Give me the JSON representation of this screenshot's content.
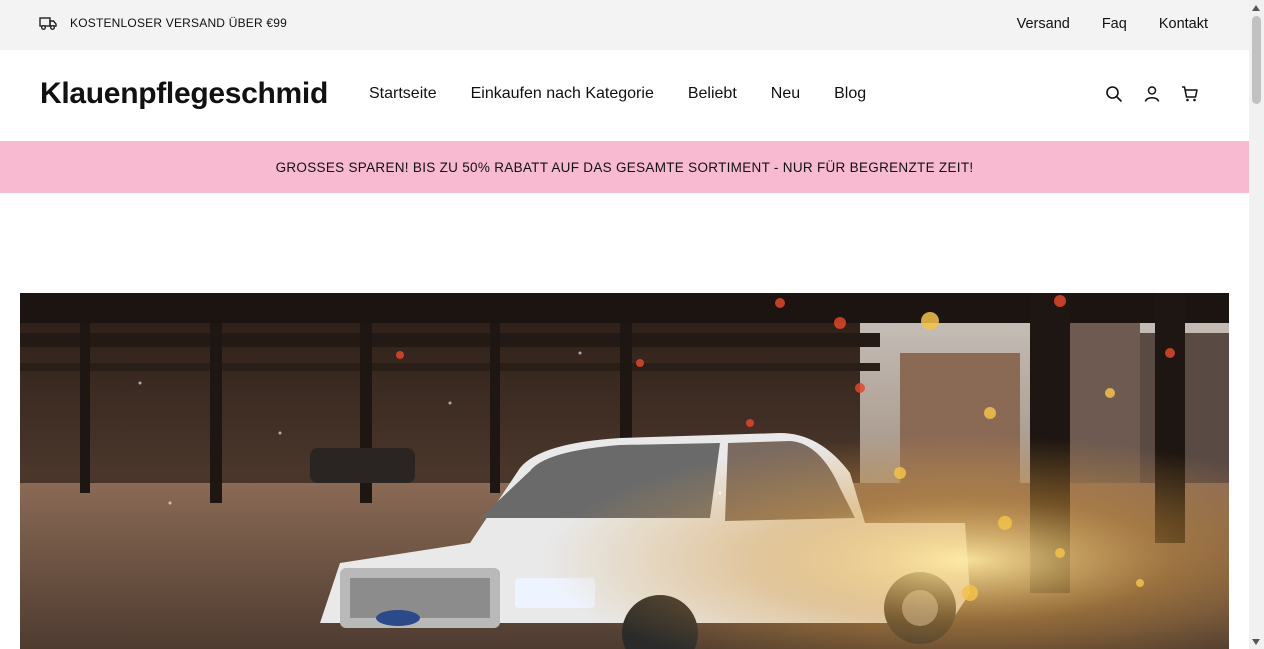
{
  "topbar": {
    "shipping_text": "KOSTENLOSER VERSAND ÜBER €99",
    "shipping_icon": "truck-icon",
    "links": [
      "Versand",
      "Faq",
      "Kontakt"
    ]
  },
  "header": {
    "logo": "Klauenpflegeschmid",
    "nav": [
      "Startseite",
      "Einkaufen nach Kategorie",
      "Beliebt",
      "Neu",
      "Blog"
    ],
    "icons": [
      "search-icon",
      "account-icon",
      "cart-icon"
    ]
  },
  "promo": {
    "text": "GROSSES SPAREN! BIS ZU 50% RABATT AUF DAS GESAMTE SORTIMENT - NUR FÜR BEGRENZTE ZEIT!",
    "background": "#f7bad1"
  },
  "hero": {
    "image": "white pickup truck under elevated railway with glowing sparks"
  }
}
